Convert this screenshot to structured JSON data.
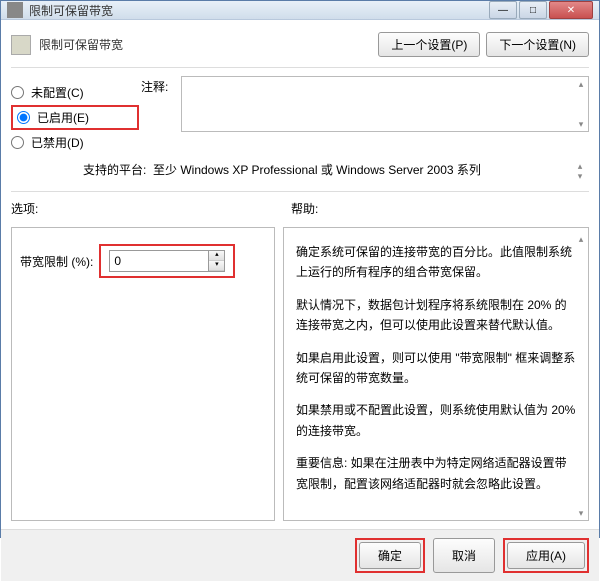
{
  "window": {
    "title": "限制可保留带宽"
  },
  "header": {
    "title": "限制可保留带宽",
    "prev": "上一个设置(P)",
    "next": "下一个设置(N)"
  },
  "radios": {
    "notconfig": "未配置(C)",
    "enabled": "已启用(E)",
    "disabled": "已禁用(D)"
  },
  "comment": {
    "label": "注释:"
  },
  "platform": {
    "label": "支持的平台:",
    "value": "至少 Windows XP Professional 或 Windows Server 2003 系列"
  },
  "panels": {
    "options": "选项:",
    "help": "帮助:"
  },
  "spinner": {
    "label": "带宽限制 (%):",
    "value": "0"
  },
  "helptext": {
    "p1": "确定系统可保留的连接带宽的百分比。此值限制系统上运行的所有程序的组合带宽保留。",
    "p2": "默认情况下，数据包计划程序将系统限制在 20% 的连接带宽之内，但可以使用此设置来替代默认值。",
    "p3": "如果启用此设置，则可以使用 \"带宽限制\" 框来调整系统可保留的带宽数量。",
    "p4": "如果禁用或不配置此设置，则系统使用默认值为 20% 的连接带宽。",
    "p5": "重要信息: 如果在注册表中为特定网络适配器设置带宽限制，配置该网络适配器时就会忽略此设置。"
  },
  "footer": {
    "ok": "确定",
    "cancel": "取消",
    "apply": "应用(A)"
  }
}
